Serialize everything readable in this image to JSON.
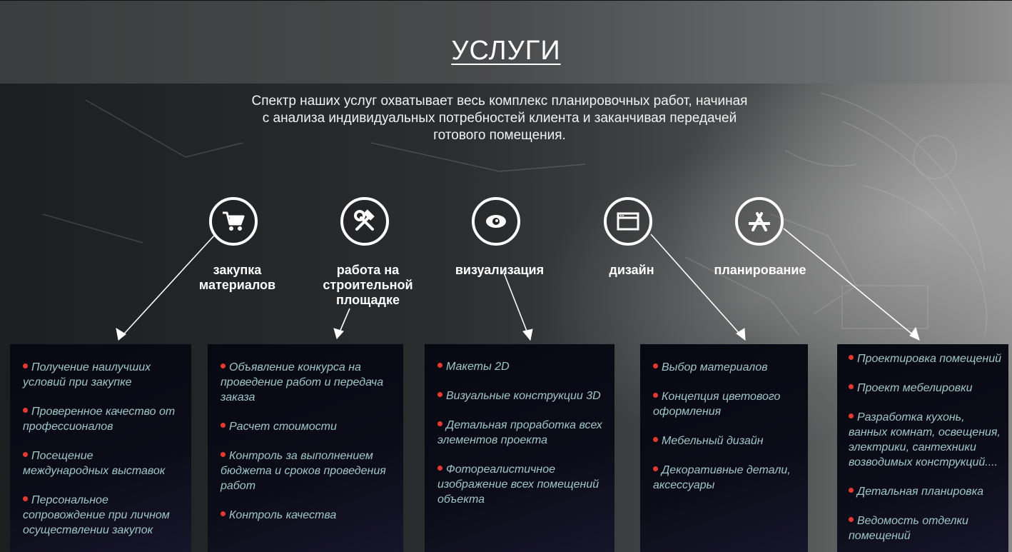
{
  "header": {
    "title": "УСЛУГИ",
    "intro": "Спектр наших услуг охватывает весь комплекс планировочных работ, начиная с анализа индивидуальных потребностей клиента и заканчивая передачей готового помещения."
  },
  "colors": {
    "bullet": "#e23a33",
    "item_text": "#9fc7c7",
    "card_bg": "#0a0a14"
  },
  "services": [
    {
      "icon": "shopping-cart-icon",
      "label": "закупка материалов",
      "items": [
        "Получение наилучших условий при закупке",
        "Проверенное качество от профессионалов",
        "Посещение международных выставок",
        "Персональное сопровождение при личном осуществлении закупок"
      ]
    },
    {
      "icon": "hammer-wrench-icon",
      "label": "работа на строительной площадке",
      "items": [
        "Объявление конкурса на проведение работ и передача заказа",
        "Расчет стоимости",
        "Контроль за выполнением бюджета и сроков проведения работ",
        "Контроль качества"
      ]
    },
    {
      "icon": "eye-icon",
      "label": "визуализация",
      "items": [
        "Макеты 2D",
        "Визуальные конструкции 3D",
        "Детальная проработка всех элементов проекта",
        "Фотореалистичное изображение всех помещений объекта"
      ]
    },
    {
      "icon": "browser-window-icon",
      "label": "дизайн",
      "items": [
        "Выбор материалов",
        "Концепция цветового оформления",
        "Мебельный дизайн",
        "Декоративные детали, аксессуары"
      ]
    },
    {
      "icon": "app-store-icon",
      "label": "планирование",
      "items": [
        "Проектировка помещений",
        "Проект мебелировки",
        "Разработка кухонь, ванных комнат, освещения, электрики, сантехники возводимых конструкций....",
        "Детальная планировка",
        "Ведомость отделки помещений"
      ]
    }
  ]
}
